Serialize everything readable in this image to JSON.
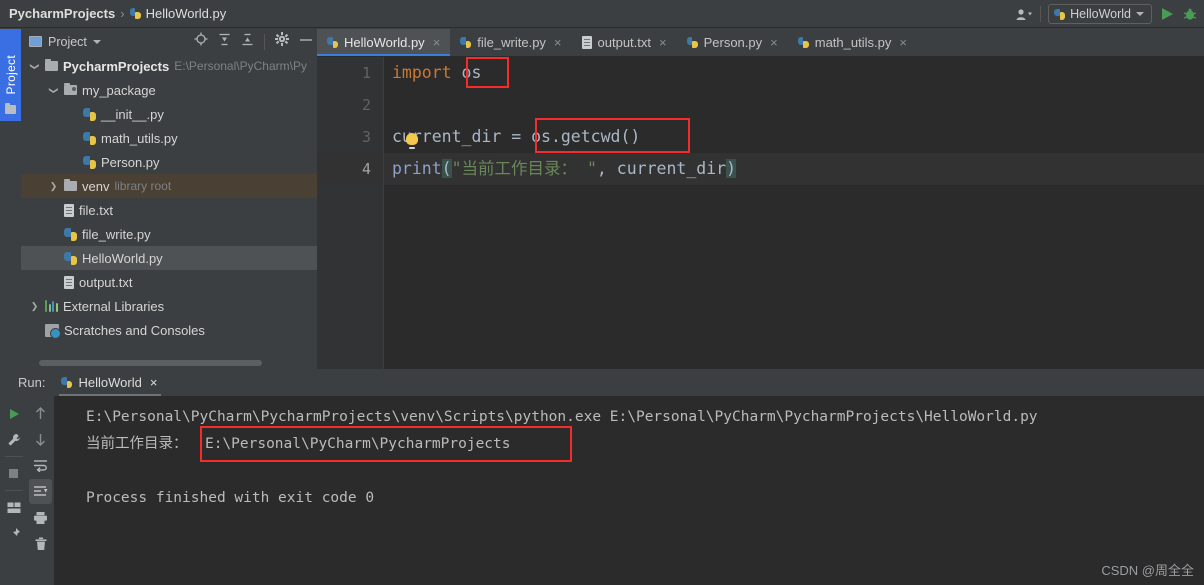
{
  "window": {
    "breadcrumb_root": "PycharmProjects",
    "breadcrumb_sep": "›",
    "breadcrumb_file": "HelloWorld.py",
    "run_config_name": "HelloWorld",
    "accent_blue": "#3a6fe3",
    "run_green": "#499c54",
    "annotation_red": "#f42c2c"
  },
  "left_strip": {
    "project_tab_label": "Project"
  },
  "project_panel": {
    "title": "Project",
    "tools": [
      "locate-icon",
      "expand-all-icon",
      "collapse-all-icon",
      "settings-gear-icon",
      "minimize-icon"
    ],
    "tree": [
      {
        "label": "PycharmProjects",
        "suffix": "E:\\Personal\\PyCharm\\Py",
        "icon": "folder-icon",
        "indent": 0,
        "chevron": "v",
        "bold": true,
        "state": "normal"
      },
      {
        "label": "my_package",
        "suffix": "",
        "icon": "package-folder-icon",
        "indent": 1,
        "chevron": "v",
        "bold": false,
        "state": "normal"
      },
      {
        "label": "__init__.py",
        "suffix": "",
        "icon": "python-file-icon",
        "indent": 2,
        "chevron": "",
        "bold": false,
        "state": "normal"
      },
      {
        "label": "math_utils.py",
        "suffix": "",
        "icon": "python-file-icon",
        "indent": 2,
        "chevron": "",
        "bold": false,
        "state": "normal"
      },
      {
        "label": "Person.py",
        "suffix": "",
        "icon": "python-file-icon",
        "indent": 2,
        "chevron": "",
        "bold": false,
        "state": "normal"
      },
      {
        "label": "venv",
        "suffix": "library root",
        "icon": "folder-icon",
        "indent": 1,
        "chevron": ">",
        "bold": false,
        "state": "venv"
      },
      {
        "label": "file.txt",
        "suffix": "",
        "icon": "text-file-icon",
        "indent": 1,
        "chevron": "",
        "bold": false,
        "state": "normal"
      },
      {
        "label": "file_write.py",
        "suffix": "",
        "icon": "python-file-icon",
        "indent": 1,
        "chevron": "",
        "bold": false,
        "state": "normal"
      },
      {
        "label": "HelloWorld.py",
        "suffix": "",
        "icon": "python-file-icon",
        "indent": 1,
        "chevron": "",
        "bold": false,
        "state": "selected"
      },
      {
        "label": "output.txt",
        "suffix": "",
        "icon": "text-file-icon",
        "indent": 1,
        "chevron": "",
        "bold": false,
        "state": "normal"
      },
      {
        "label": "External Libraries",
        "suffix": "",
        "icon": "libraries-icon",
        "indent": 0,
        "chevron": ">",
        "bold": false,
        "state": "normal"
      },
      {
        "label": "Scratches and Consoles",
        "suffix": "",
        "icon": "scratches-icon",
        "indent": 0,
        "chevron": "",
        "bold": false,
        "state": "normal"
      }
    ]
  },
  "editor": {
    "tabs": [
      {
        "label": "HelloWorld.py",
        "icon": "python-file-icon",
        "active": true
      },
      {
        "label": "file_write.py",
        "icon": "python-file-icon",
        "active": false
      },
      {
        "label": "output.txt",
        "icon": "text-file-icon",
        "active": false
      },
      {
        "label": "Person.py",
        "icon": "python-file-icon",
        "active": false
      },
      {
        "label": "math_utils.py",
        "icon": "python-file-icon",
        "active": false
      }
    ],
    "close_glyph": "×",
    "line_numbers": [
      "1",
      "2",
      "3",
      "4"
    ],
    "current_line": 4,
    "code": {
      "l1_kw": "import",
      "l1_rest": " os",
      "l2": "",
      "l3": "current_dir = os.getcwd()",
      "l4_fn": "print",
      "l4_open": "(",
      "l4_str": "\"当前工作目录： \"",
      "l4_mid": ", current_dir",
      "l4_close": ")"
    }
  },
  "run_panel": {
    "run_label": "Run:",
    "tab_label": "HelloWorld",
    "close_glyph": "×",
    "tools_left": [
      "rerun-play-icon",
      "wrench-settings-icon",
      "stop-icon",
      "layout-icon",
      "pin-icon"
    ],
    "tools_right": [
      "up-arrow-icon",
      "down-arrow-icon",
      "soft-wrap-icon",
      "scroll-to-end-icon",
      "print-icon",
      "trash-icon"
    ],
    "console_lines": [
      "E:\\Personal\\PyCharm\\PycharmProjects\\venv\\Scripts\\python.exe E:\\Personal\\PyCharm\\PycharmProjects\\HelloWorld.py",
      "当前工作目录：  E:\\Personal\\PyCharm\\PycharmProjects",
      "",
      "Process finished with exit code 0"
    ]
  },
  "watermark": "CSDN @周全全"
}
